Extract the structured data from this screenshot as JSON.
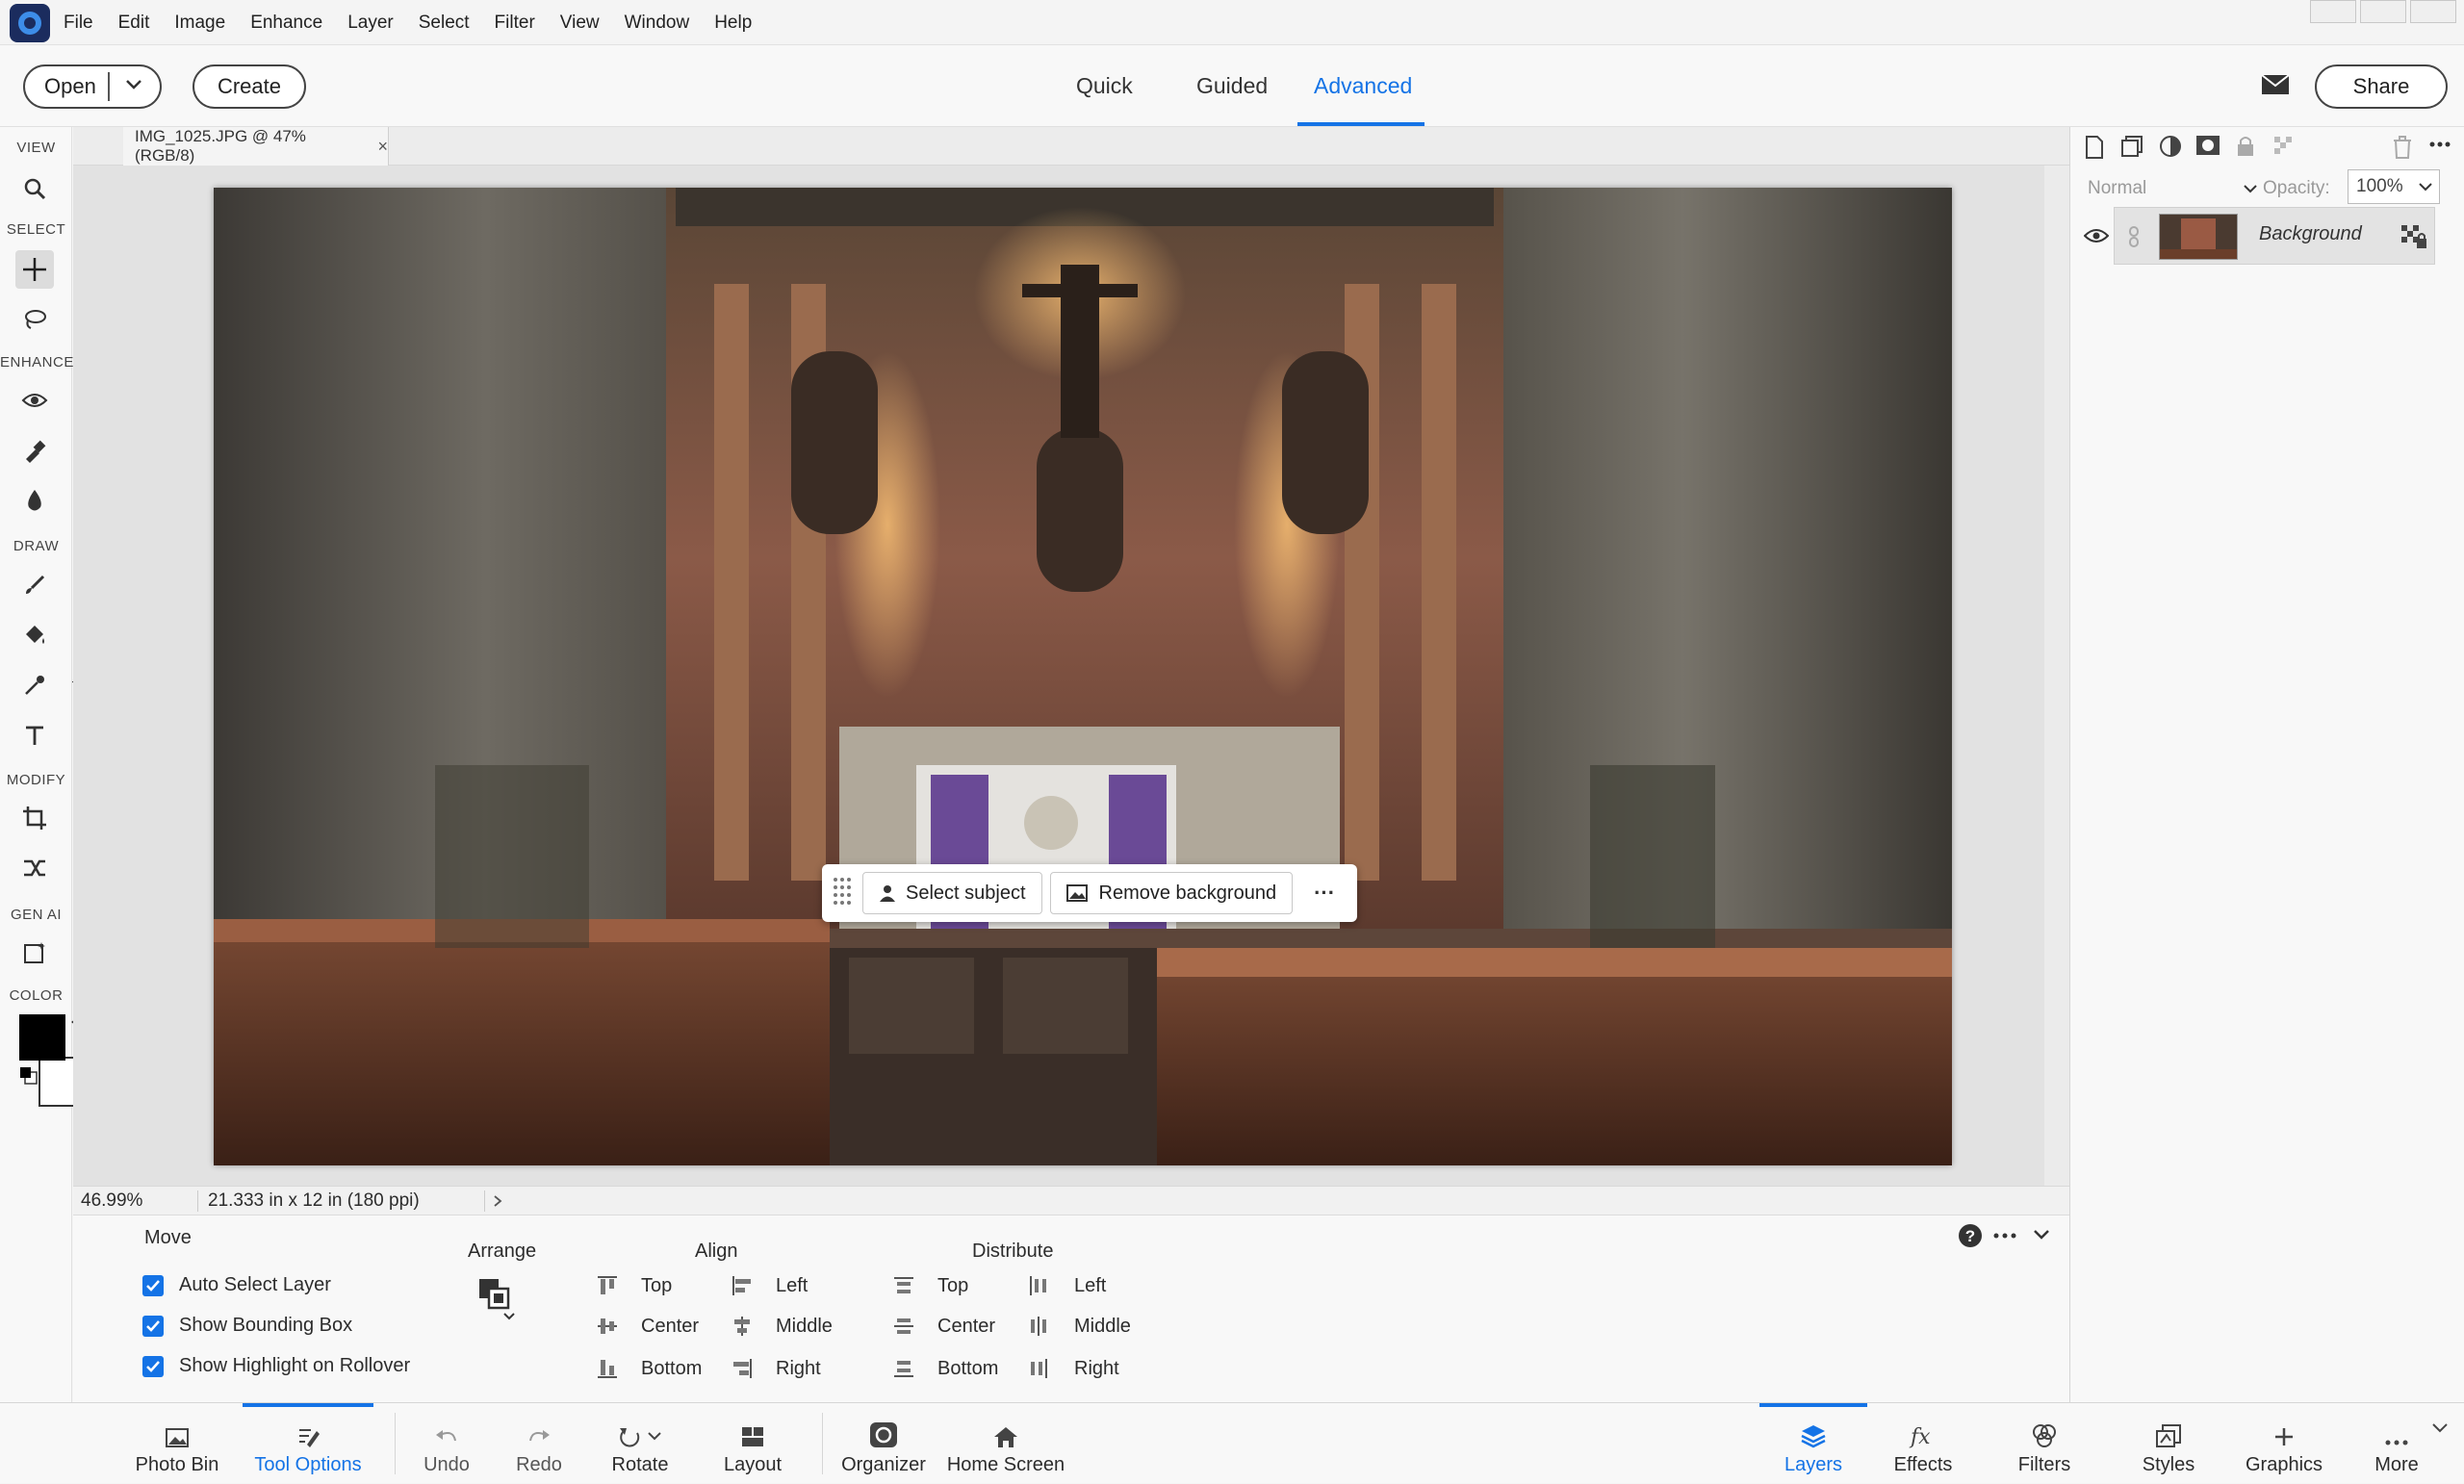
{
  "menubar": {
    "items": [
      "File",
      "Edit",
      "Image",
      "Enhance",
      "Layer",
      "Select",
      "Filter",
      "View",
      "Window",
      "Help"
    ]
  },
  "header": {
    "open_label": "Open",
    "create_label": "Create",
    "share_label": "Share",
    "modes": [
      "Quick",
      "Guided",
      "Advanced"
    ],
    "active_mode": "Advanced"
  },
  "toolbar": {
    "sections": [
      "VIEW",
      "SELECT",
      "ENHANCE",
      "DRAW",
      "MODIFY",
      "GEN AI",
      "COLOR"
    ],
    "foreground_color": "#000000",
    "background_color": "#ffffff"
  },
  "document": {
    "tab_label": "IMG_1025.JPG @ 47% (RGB/8)",
    "close_glyph": "×"
  },
  "quick_actions": {
    "select_subject": "Select subject",
    "remove_background": "Remove background",
    "more": "···"
  },
  "status": {
    "zoom": "46.99%",
    "dimensions": "21.333 in x 12 in (180 ppi)"
  },
  "layers_panel": {
    "blend_mode": "Normal",
    "opacity_label": "Opacity:",
    "opacity_value": "100%",
    "layers": [
      {
        "name": "Background"
      }
    ]
  },
  "tool_options": {
    "tool_name": "Move",
    "checkboxes": [
      {
        "label": "Auto Select Layer",
        "checked": true
      },
      {
        "label": "Show Bounding Box",
        "checked": true
      },
      {
        "label": "Show Highlight on Rollover",
        "checked": true
      }
    ],
    "arrange_label": "Arrange",
    "align_label": "Align",
    "align_items": [
      "Top",
      "Center",
      "Bottom",
      "Left",
      "Middle",
      "Right"
    ],
    "distribute_label": "Distribute",
    "distribute_items": [
      "Top",
      "Center",
      "Bottom",
      "Left",
      "Middle",
      "Right"
    ]
  },
  "taskbar": {
    "left": [
      "Photo Bin",
      "Tool Options",
      "Undo",
      "Redo",
      "Rotate",
      "Layout",
      "Organizer",
      "Home Screen"
    ],
    "right": [
      "Layers",
      "Effects",
      "Filters",
      "Styles",
      "Graphics",
      "More"
    ],
    "active": [
      "Tool Options",
      "Layers"
    ]
  },
  "colors": {
    "accent": "#1473e6"
  }
}
